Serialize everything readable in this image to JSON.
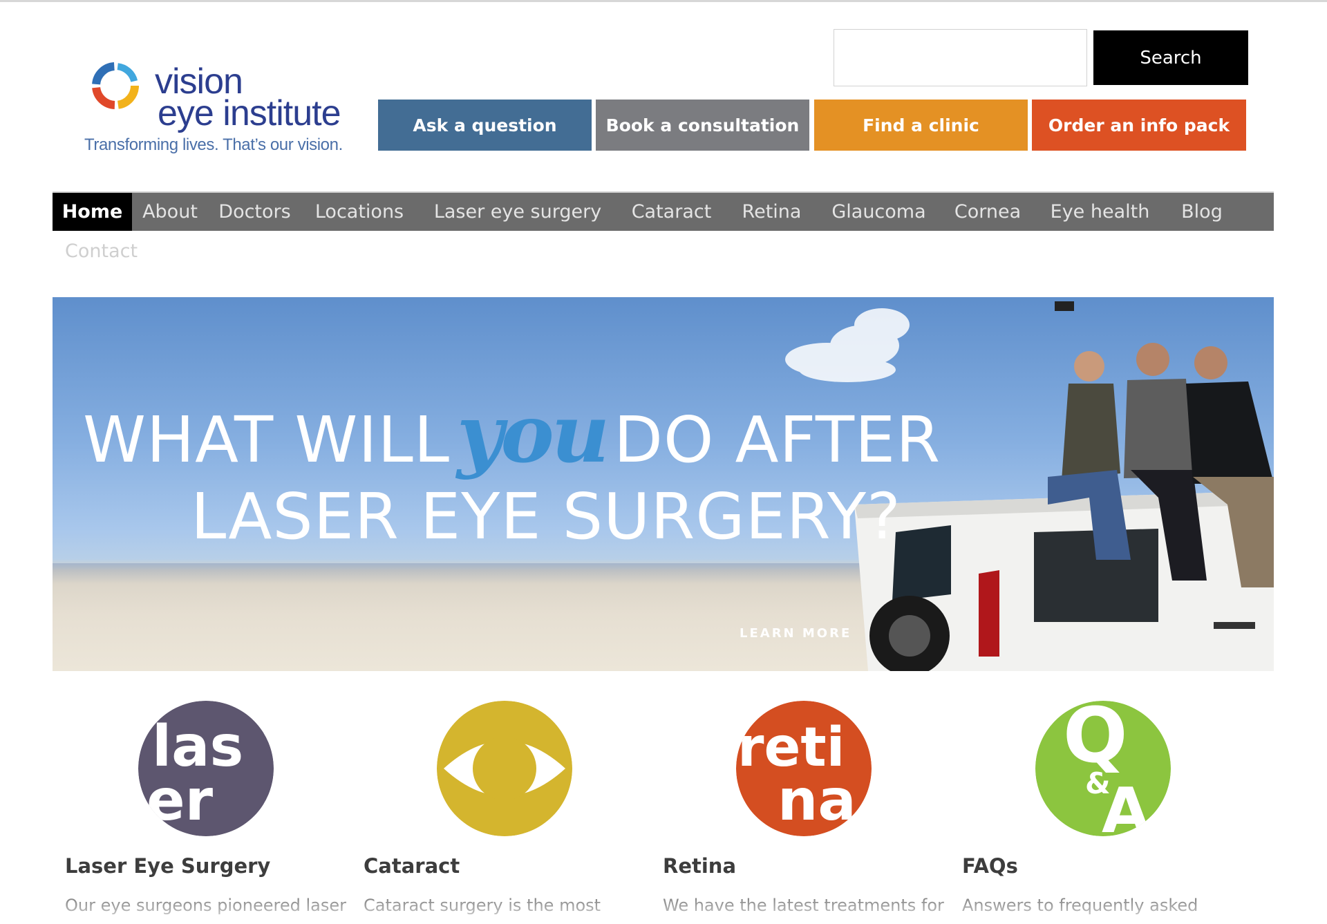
{
  "brand": {
    "name_line1": "vision",
    "name_line2": "eye institute",
    "tagline": "Transforming lives. That’s our vision."
  },
  "search": {
    "placeholder": "",
    "value": "",
    "button_label": "Search"
  },
  "cta_buttons": [
    {
      "label": "Ask a question",
      "color": "#436d94"
    },
    {
      "label": "Book a consultation",
      "color": "#7b7c80"
    },
    {
      "label": "Find a clinic",
      "color": "#e49124"
    },
    {
      "label": "Order an info pack",
      "color": "#dd5123"
    }
  ],
  "nav": {
    "items": [
      {
        "label": "Home",
        "active": true
      },
      {
        "label": "About"
      },
      {
        "label": "Doctors"
      },
      {
        "label": "Locations"
      },
      {
        "label": "Laser eye surgery"
      },
      {
        "label": "Cataract"
      },
      {
        "label": "Retina"
      },
      {
        "label": "Glaucoma"
      },
      {
        "label": "Cornea"
      },
      {
        "label": "Eye health"
      },
      {
        "label": "Blog"
      }
    ],
    "contact_label": "Contact"
  },
  "hero": {
    "line1_before": "WHAT WILL",
    "line1_emphasis": "you",
    "line1_after": "DO AFTER",
    "line2": "LASER EYE SURGERY?",
    "link_label": "LEARN MORE"
  },
  "features": [
    {
      "icon": "laser-icon",
      "icon_text_top": "las",
      "icon_text_bottom": "er",
      "color": "#5d566f",
      "title": "Laser Eye Surgery",
      "text": "Our eye surgeons pioneered laser"
    },
    {
      "icon": "eye-icon",
      "color": "#d4b52e",
      "title": "Cataract",
      "text": "Cataract surgery is the most"
    },
    {
      "icon": "retina-icon",
      "icon_text_top": "reti",
      "icon_text_bottom": "na",
      "color": "#d44e21",
      "title": "Retina",
      "text": "We have the latest treatments for"
    },
    {
      "icon": "qa-icon",
      "icon_text_top": "Q",
      "icon_text_amp": "&",
      "icon_text_bottom": "A",
      "color": "#8cc53f",
      "title": "FAQs",
      "text": "Answers to frequently asked"
    }
  ]
}
